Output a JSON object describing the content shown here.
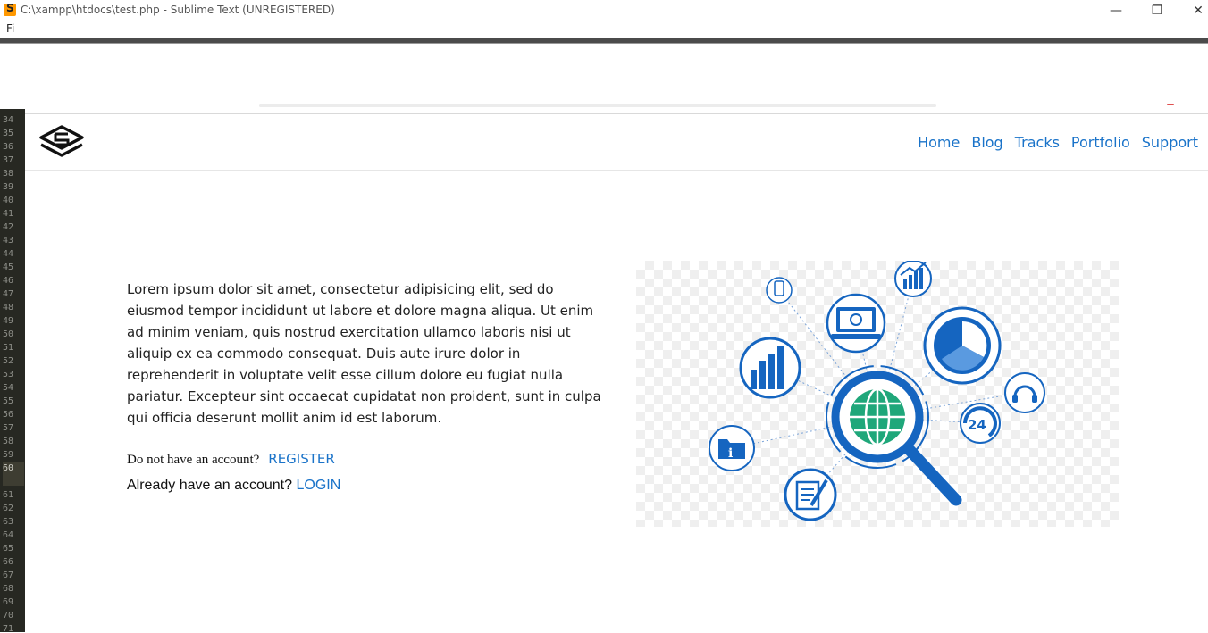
{
  "window": {
    "title": "C:\\xampp\\htdocs\\test.php - Sublime Text (UNREGISTERED)",
    "minimize_glyph": "—",
    "restore_glyph": "❐",
    "close_glyph": "✕",
    "app_icon_letter": "S"
  },
  "menubar": {
    "item": "Fi"
  },
  "gutter": {
    "line_numbers": [
      "34",
      "35",
      "36",
      "37",
      "38",
      "39",
      "40",
      "41",
      "42",
      "43",
      "44",
      "45",
      "46",
      "47",
      "48",
      "49",
      "50",
      "51",
      "52",
      "53",
      "54",
      "55",
      "56",
      "57",
      "58",
      "59",
      "60",
      "",
      "61",
      "62",
      "63",
      "64",
      "65",
      "66",
      "67",
      "68",
      "69",
      "70",
      "71"
    ],
    "active_line": "60"
  },
  "site": {
    "logo": "layered-s-logo",
    "nav": [
      "Home",
      "Blog",
      "Tracks",
      "Portfolio",
      "Support"
    ],
    "lorem": "Lorem ipsum dolor sit amet, consectetur adipisicing elit, sed do eiusmod tempor incididunt ut labore et dolore magna aliqua. Ut enim ad minim veniam, quis nostrud exercitation ullamco laboris nisi ut aliquip ex ea commodo consequat. Duis aute irure dolor in reprehenderit in voluptate velit esse cillum dolore eu fugiat nulla pariatur. Excepteur sint occaecat cupidatat non proident, sunt in culpa qui officia deserunt mollit anim id est laborum.",
    "register_question": "Do not have an account?",
    "register_link": "REGISTER",
    "login_question": "Already have an account? ",
    "login_link": "LOGIN",
    "illustration": {
      "badge_text": "24",
      "colors": {
        "blue": "#1565c0",
        "green": "#1fa77a",
        "link": "#1a73c9"
      }
    }
  }
}
